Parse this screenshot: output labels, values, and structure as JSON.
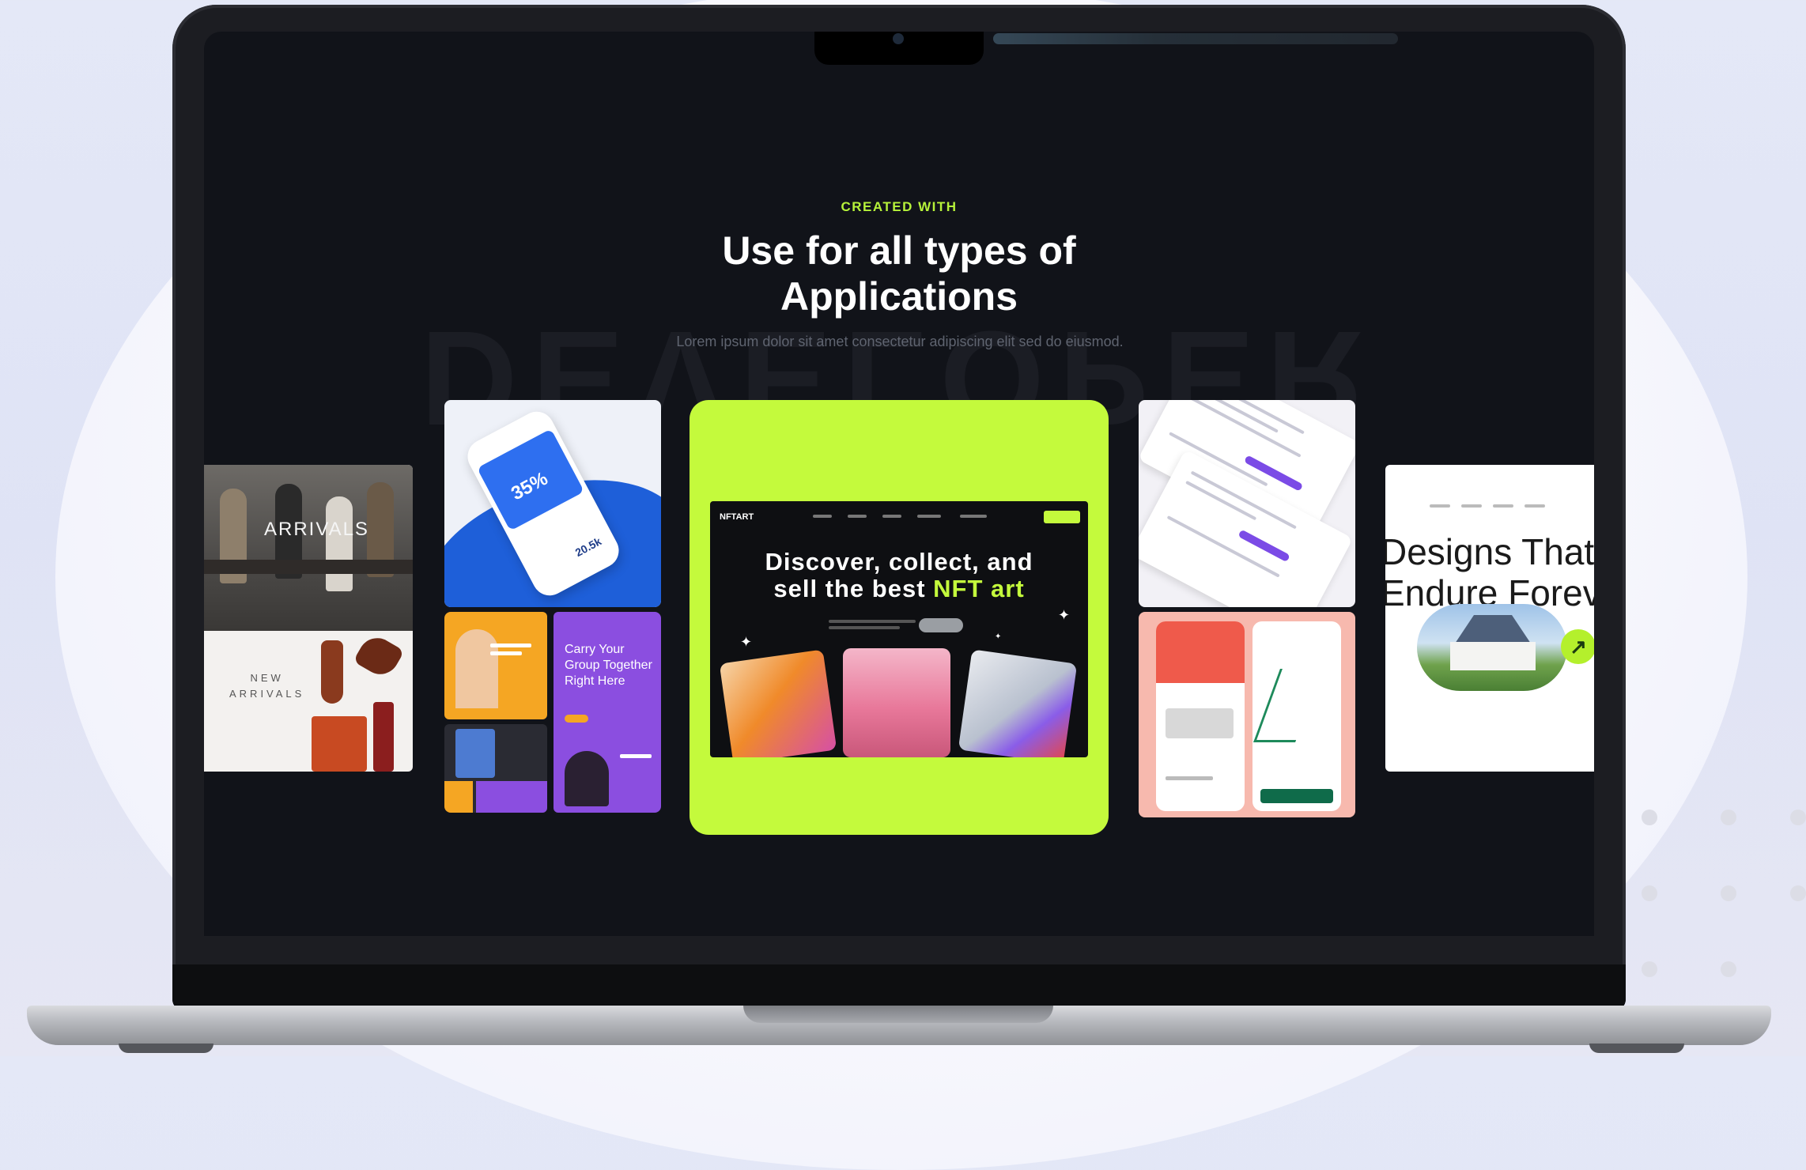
{
  "section": {
    "eyebrow": "CREATED WITH",
    "title_line1": "Use for all types of",
    "title_line2": "Applications",
    "subtitle": "Lorem ipsum dolor sit amet consectetur adipiscing elit sed do eiusmod.",
    "background_word": "DEVELOPER"
  },
  "cards": {
    "fashion": {
      "banner": "ARRIVALS",
      "caption_line1": "NEW",
      "caption_line2": "ARRIVALS"
    },
    "finance": {
      "percent": "35%",
      "amount": "20.5k"
    },
    "mosaic": {
      "purple_text": "Carry Your Group Together Right Here"
    },
    "nft": {
      "logo": "NFTART",
      "headline_line1": "Discover, collect, and",
      "headline_line2_prefix": "sell the best ",
      "headline_line2_highlight": "NFT art"
    },
    "estate": {
      "headline_line1": "Designs That",
      "headline_line2": "Endure Forever"
    }
  },
  "colors": {
    "accent_lime": "#c4fa3c",
    "screen_bg": "#111319",
    "delivery_pink": "#f7b9ae",
    "finance_blue": "#1e5fd9",
    "mosaic_purple": "#8b4ee0",
    "mosaic_orange": "#f5a623"
  },
  "icons": [
    "camera-icon",
    "star-icon",
    "arrow-up-right-icon"
  ]
}
